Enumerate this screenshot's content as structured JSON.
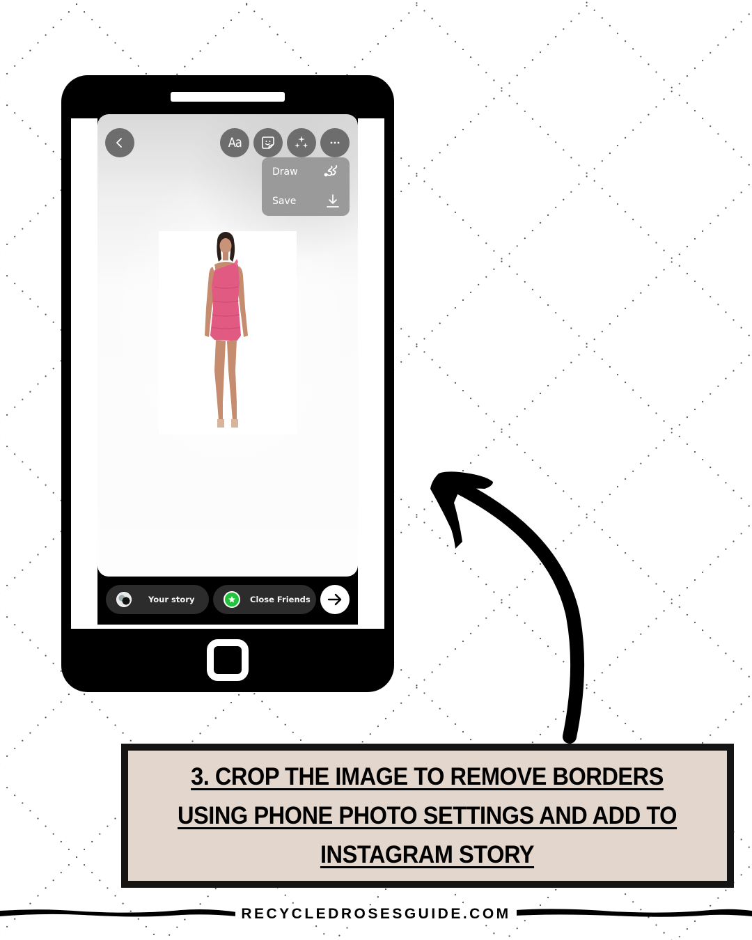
{
  "colors": {
    "phone_body": "#000000",
    "caption_fill": "#e3d6cd",
    "caption_border": "#141414",
    "toolbar_button": "#6d6d6d",
    "menu_bg": "#9a9a9a",
    "pill_bg": "#2c2c2c",
    "close_friends_green": "#21c33c",
    "pattern_dot": "#555555"
  },
  "phone": {
    "app": "Instagram Story editor",
    "toolbar": {
      "back_icon": "chevron-left-icon",
      "text_button_label": "Aa",
      "sticker_icon": "sticker-icon",
      "effects_icon": "sparkles-icon",
      "more_icon": "ellipsis-icon"
    },
    "menu": {
      "items": [
        {
          "label": "Draw",
          "icon": "squiggle-draw-icon"
        },
        {
          "label": "Save",
          "icon": "download-icon"
        }
      ]
    },
    "photo": {
      "description": "Model wearing a pink one-shoulder ruched mini dress"
    },
    "share_bar": {
      "your_story_label": "Your story",
      "close_friends_label": "Close Friends",
      "next_icon": "arrow-right-icon"
    }
  },
  "caption": {
    "line1": "3. CROP THE IMAGE TO REMOVE BORDERS",
    "line2": "USING PHONE PHOTO SETTINGS AND ADD TO",
    "line3": "INSTAGRAM STORY"
  },
  "footer": {
    "site": "RECYCLEDROSESGUIDE.COM"
  }
}
